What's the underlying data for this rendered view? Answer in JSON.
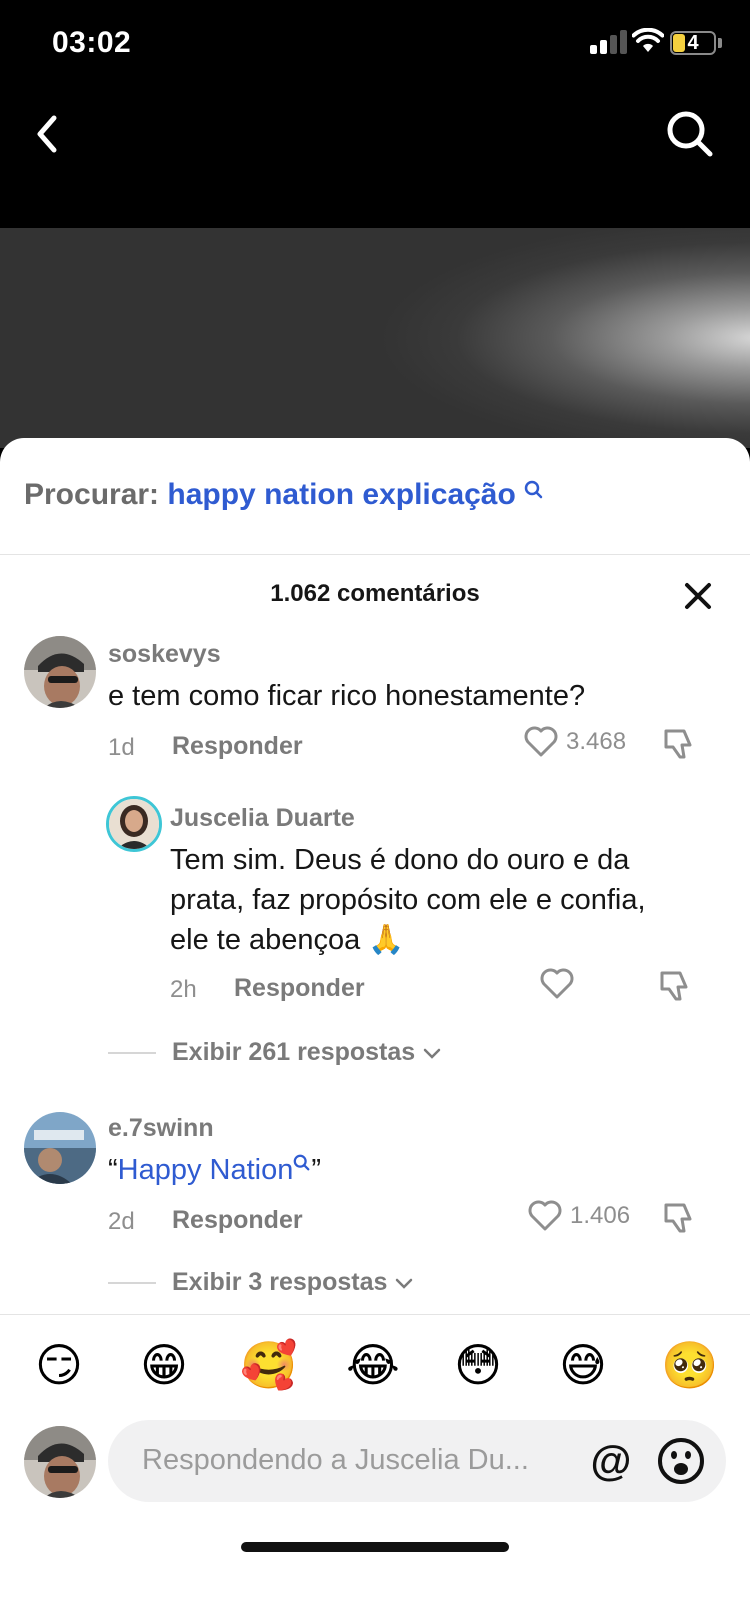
{
  "status_bar": {
    "time": "03:02",
    "battery_level": "4"
  },
  "search": {
    "prefix": "Procurar:",
    "term": "happy nation explicação"
  },
  "comments_header": {
    "count_label": "1.062 comentários"
  },
  "comments": [
    {
      "username": "soskevys",
      "text": "e tem como ficar rico honestamente?",
      "age": "1d",
      "reply_label": "Responder",
      "likes": "3.468",
      "view_replies_label": "Exibir 261 respostas"
    },
    {
      "username": "e.7swinn",
      "text_open_quote": "“",
      "text_link": "Happy Nation",
      "text_close_quote": "”",
      "age": "2d",
      "reply_label": "Responder",
      "likes": "1.406",
      "view_replies_label": "Exibir 3 respostas"
    }
  ],
  "reply": {
    "username": "Juscelia Duarte",
    "text_line1": "Tem sim. Deus é dono do ouro e da",
    "text_line2": "prata, faz propósito com ele e confia,",
    "text_line3": "ele te abençoa 🙏",
    "age": "2h",
    "reply_label": "Responder"
  },
  "emoji_bar": [
    "😏",
    "😁",
    "🥰",
    "😂",
    "😳",
    "😅",
    "🥺"
  ],
  "composer": {
    "placeholder": "Respondendo a Juscelia Du...",
    "mention_symbol": "@"
  },
  "colors": {
    "accent_blue": "#2f5bd1",
    "sheet_bg": "#ffffff",
    "input_bg": "#f1f1f2"
  }
}
